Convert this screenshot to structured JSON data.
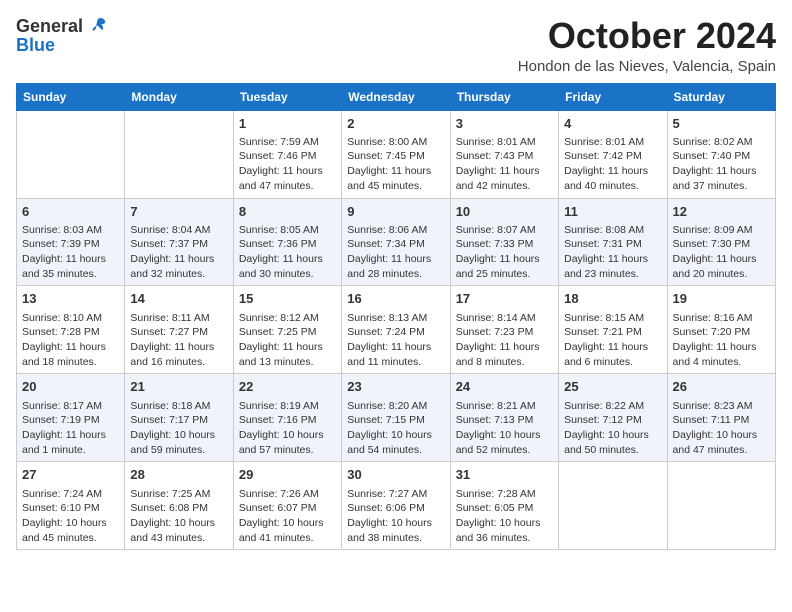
{
  "header": {
    "logo_general": "General",
    "logo_blue": "Blue",
    "month": "October 2024",
    "location": "Hondon de las Nieves, Valencia, Spain"
  },
  "columns": [
    "Sunday",
    "Monday",
    "Tuesday",
    "Wednesday",
    "Thursday",
    "Friday",
    "Saturday"
  ],
  "weeks": [
    [
      {
        "day": "",
        "sunrise": "",
        "sunset": "",
        "daylight": ""
      },
      {
        "day": "",
        "sunrise": "",
        "sunset": "",
        "daylight": ""
      },
      {
        "day": "1",
        "sunrise": "Sunrise: 7:59 AM",
        "sunset": "Sunset: 7:46 PM",
        "daylight": "Daylight: 11 hours and 47 minutes."
      },
      {
        "day": "2",
        "sunrise": "Sunrise: 8:00 AM",
        "sunset": "Sunset: 7:45 PM",
        "daylight": "Daylight: 11 hours and 45 minutes."
      },
      {
        "day": "3",
        "sunrise": "Sunrise: 8:01 AM",
        "sunset": "Sunset: 7:43 PM",
        "daylight": "Daylight: 11 hours and 42 minutes."
      },
      {
        "day": "4",
        "sunrise": "Sunrise: 8:01 AM",
        "sunset": "Sunset: 7:42 PM",
        "daylight": "Daylight: 11 hours and 40 minutes."
      },
      {
        "day": "5",
        "sunrise": "Sunrise: 8:02 AM",
        "sunset": "Sunset: 7:40 PM",
        "daylight": "Daylight: 11 hours and 37 minutes."
      }
    ],
    [
      {
        "day": "6",
        "sunrise": "Sunrise: 8:03 AM",
        "sunset": "Sunset: 7:39 PM",
        "daylight": "Daylight: 11 hours and 35 minutes."
      },
      {
        "day": "7",
        "sunrise": "Sunrise: 8:04 AM",
        "sunset": "Sunset: 7:37 PM",
        "daylight": "Daylight: 11 hours and 32 minutes."
      },
      {
        "day": "8",
        "sunrise": "Sunrise: 8:05 AM",
        "sunset": "Sunset: 7:36 PM",
        "daylight": "Daylight: 11 hours and 30 minutes."
      },
      {
        "day": "9",
        "sunrise": "Sunrise: 8:06 AM",
        "sunset": "Sunset: 7:34 PM",
        "daylight": "Daylight: 11 hours and 28 minutes."
      },
      {
        "day": "10",
        "sunrise": "Sunrise: 8:07 AM",
        "sunset": "Sunset: 7:33 PM",
        "daylight": "Daylight: 11 hours and 25 minutes."
      },
      {
        "day": "11",
        "sunrise": "Sunrise: 8:08 AM",
        "sunset": "Sunset: 7:31 PM",
        "daylight": "Daylight: 11 hours and 23 minutes."
      },
      {
        "day": "12",
        "sunrise": "Sunrise: 8:09 AM",
        "sunset": "Sunset: 7:30 PM",
        "daylight": "Daylight: 11 hours and 20 minutes."
      }
    ],
    [
      {
        "day": "13",
        "sunrise": "Sunrise: 8:10 AM",
        "sunset": "Sunset: 7:28 PM",
        "daylight": "Daylight: 11 hours and 18 minutes."
      },
      {
        "day": "14",
        "sunrise": "Sunrise: 8:11 AM",
        "sunset": "Sunset: 7:27 PM",
        "daylight": "Daylight: 11 hours and 16 minutes."
      },
      {
        "day": "15",
        "sunrise": "Sunrise: 8:12 AM",
        "sunset": "Sunset: 7:25 PM",
        "daylight": "Daylight: 11 hours and 13 minutes."
      },
      {
        "day": "16",
        "sunrise": "Sunrise: 8:13 AM",
        "sunset": "Sunset: 7:24 PM",
        "daylight": "Daylight: 11 hours and 11 minutes."
      },
      {
        "day": "17",
        "sunrise": "Sunrise: 8:14 AM",
        "sunset": "Sunset: 7:23 PM",
        "daylight": "Daylight: 11 hours and 8 minutes."
      },
      {
        "day": "18",
        "sunrise": "Sunrise: 8:15 AM",
        "sunset": "Sunset: 7:21 PM",
        "daylight": "Daylight: 11 hours and 6 minutes."
      },
      {
        "day": "19",
        "sunrise": "Sunrise: 8:16 AM",
        "sunset": "Sunset: 7:20 PM",
        "daylight": "Daylight: 11 hours and 4 minutes."
      }
    ],
    [
      {
        "day": "20",
        "sunrise": "Sunrise: 8:17 AM",
        "sunset": "Sunset: 7:19 PM",
        "daylight": "Daylight: 11 hours and 1 minute."
      },
      {
        "day": "21",
        "sunrise": "Sunrise: 8:18 AM",
        "sunset": "Sunset: 7:17 PM",
        "daylight": "Daylight: 10 hours and 59 minutes."
      },
      {
        "day": "22",
        "sunrise": "Sunrise: 8:19 AM",
        "sunset": "Sunset: 7:16 PM",
        "daylight": "Daylight: 10 hours and 57 minutes."
      },
      {
        "day": "23",
        "sunrise": "Sunrise: 8:20 AM",
        "sunset": "Sunset: 7:15 PM",
        "daylight": "Daylight: 10 hours and 54 minutes."
      },
      {
        "day": "24",
        "sunrise": "Sunrise: 8:21 AM",
        "sunset": "Sunset: 7:13 PM",
        "daylight": "Daylight: 10 hours and 52 minutes."
      },
      {
        "day": "25",
        "sunrise": "Sunrise: 8:22 AM",
        "sunset": "Sunset: 7:12 PM",
        "daylight": "Daylight: 10 hours and 50 minutes."
      },
      {
        "day": "26",
        "sunrise": "Sunrise: 8:23 AM",
        "sunset": "Sunset: 7:11 PM",
        "daylight": "Daylight: 10 hours and 47 minutes."
      }
    ],
    [
      {
        "day": "27",
        "sunrise": "Sunrise: 7:24 AM",
        "sunset": "Sunset: 6:10 PM",
        "daylight": "Daylight: 10 hours and 45 minutes."
      },
      {
        "day": "28",
        "sunrise": "Sunrise: 7:25 AM",
        "sunset": "Sunset: 6:08 PM",
        "daylight": "Daylight: 10 hours and 43 minutes."
      },
      {
        "day": "29",
        "sunrise": "Sunrise: 7:26 AM",
        "sunset": "Sunset: 6:07 PM",
        "daylight": "Daylight: 10 hours and 41 minutes."
      },
      {
        "day": "30",
        "sunrise": "Sunrise: 7:27 AM",
        "sunset": "Sunset: 6:06 PM",
        "daylight": "Daylight: 10 hours and 38 minutes."
      },
      {
        "day": "31",
        "sunrise": "Sunrise: 7:28 AM",
        "sunset": "Sunset: 6:05 PM",
        "daylight": "Daylight: 10 hours and 36 minutes."
      },
      {
        "day": "",
        "sunrise": "",
        "sunset": "",
        "daylight": ""
      },
      {
        "day": "",
        "sunrise": "",
        "sunset": "",
        "daylight": ""
      }
    ]
  ]
}
